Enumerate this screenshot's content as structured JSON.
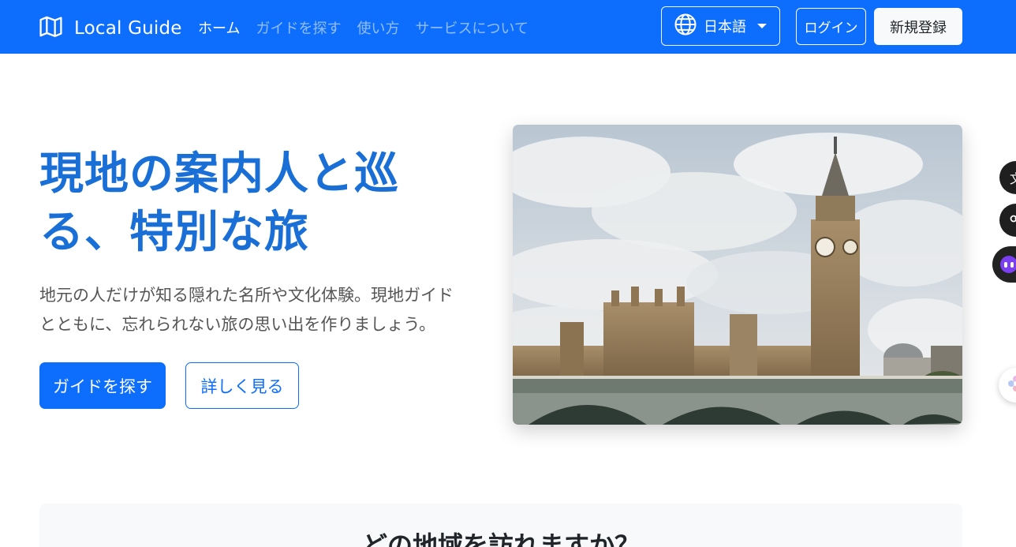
{
  "navbar": {
    "brand": "Local Guide",
    "brand_icon": "map-icon",
    "links": [
      "ホーム",
      "ガイドを探す",
      "使い方",
      "サービスについて"
    ],
    "active_index": 0,
    "language": "日本語",
    "language_icon": "globe-icon",
    "login": "ログイン",
    "signup": "新規登録"
  },
  "hero": {
    "title_line1": "現地の案内人と巡",
    "title_line2": "る、特別な旅",
    "subtitle_line1": "地元の人だけが知る隠れた名所や文化体験。現地ガイド",
    "subtitle_line2": "とともに、忘れられない旅の思い出を作りましょう。",
    "primary_button": "ガイドを探す",
    "secondary_button": "詳しく見る"
  },
  "regions": {
    "title": "どの地域を訪れますか？"
  },
  "side_widgets": {
    "first_glyph": "文"
  },
  "colors": {
    "primary": "#0d6efd",
    "title": "#1a6fd6",
    "section_bg": "#f8f9fa"
  }
}
